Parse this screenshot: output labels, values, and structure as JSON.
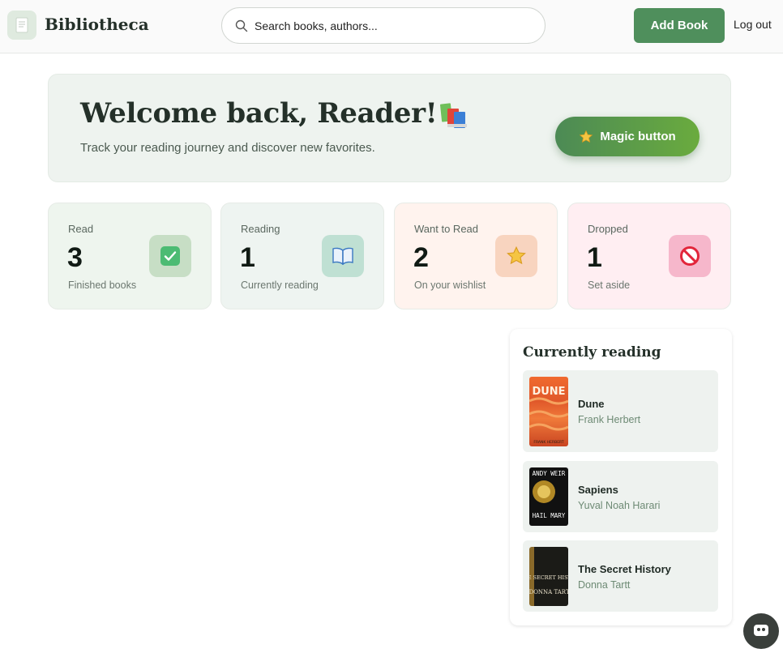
{
  "header": {
    "app_title": "Bibliotheca",
    "search_placeholder": "Search books, authors...",
    "add_book_label": "Add Book",
    "logout_label": "Log out"
  },
  "welcome": {
    "title": "Welcome back, Reader!",
    "subtitle": "Track your reading journey and discover new favorites.",
    "magic_button_label": "Magic button"
  },
  "stats": [
    {
      "label": "Read",
      "value": "3",
      "caption": "Finished books",
      "icon": "check-icon",
      "bg": "#eef5ee",
      "icon_bg": "#c7dec5"
    },
    {
      "label": "Reading",
      "value": "1",
      "caption": "Currently reading",
      "icon": "open-book-icon",
      "bg": "#eef4f1",
      "icon_bg": "#bfe0d3"
    },
    {
      "label": "Want to Read",
      "value": "2",
      "caption": "On your wishlist",
      "icon": "star-icon",
      "bg": "#fff3ee",
      "icon_bg": "#f8d4bf"
    },
    {
      "label": "Dropped",
      "value": "1",
      "caption": "Set aside",
      "icon": "prohibited-icon",
      "bg": "#ffeef2",
      "icon_bg": "#f6b7cb"
    }
  ],
  "currently_reading": {
    "title": "Currently reading",
    "books": [
      {
        "title": "Dune",
        "author": "Frank Herbert",
        "cover_text": "DUNE",
        "cover_author": "FRANK HERBERT"
      },
      {
        "title": "Sapiens",
        "author": "Yuval Noah Harari",
        "cover_text": "HAIL MARY",
        "cover_author": "ANDY WEIR"
      },
      {
        "title": "The Secret History",
        "author": "Donna Tartt",
        "cover_text": "THE SECRET HISTORY",
        "cover_author": "DONNA TARTT"
      }
    ]
  },
  "colors": {
    "accent": "#4f8f5c",
    "welcome_bg": "#eef3ef"
  }
}
